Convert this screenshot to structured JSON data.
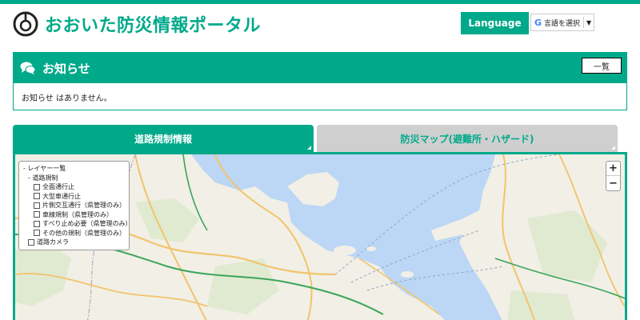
{
  "header": {
    "site_title": "おおいた防災情報ポータル",
    "language_label": "Language",
    "translate_label": "言語を選択",
    "translate_arrow": "▼",
    "translate_logo": "G",
    "accent_color": "#00a98a"
  },
  "notice": {
    "title": "お知らせ",
    "list_button": "一覧",
    "body": "お知らせ はありません。"
  },
  "tabs": [
    {
      "label": "道路規制情報",
      "active": true
    },
    {
      "label": "防災マップ(避難所・ハザード)",
      "active": false
    }
  ],
  "map": {
    "zoom_in": "+",
    "zoom_out": "−",
    "layer_panel": {
      "root": "レイヤー一覧",
      "group": "道路規制",
      "items": [
        "全面通行止",
        "大型車通行止",
        "片側交互通行（県管理のみ）",
        "車線規制（県管理のみ）",
        "すべり止め必要（県管理のみ）",
        "その他の規制（県管理のみ）"
      ],
      "camera": "道路カメラ"
    }
  }
}
